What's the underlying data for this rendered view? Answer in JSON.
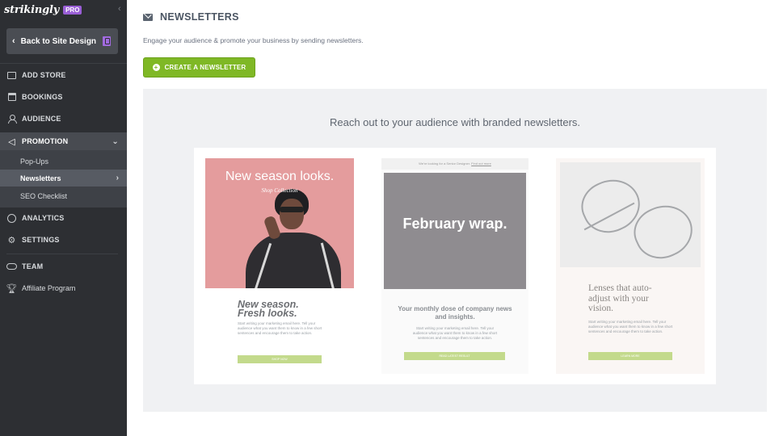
{
  "brand": {
    "logo": "strikingly",
    "badge": "PRO"
  },
  "sidebar": {
    "collapse_glyph": "‹",
    "back_label": "Back to Site Design",
    "items": [
      {
        "label": "ADD STORE",
        "icon": "store-icon"
      },
      {
        "label": "BOOKINGS",
        "icon": "calendar-icon"
      },
      {
        "label": "AUDIENCE",
        "icon": "audience-icon"
      },
      {
        "label": "PROMOTION",
        "icon": "megaphone-icon"
      },
      {
        "label": "ANALYTICS",
        "icon": "analytics-icon"
      },
      {
        "label": "SETTINGS",
        "icon": "gear-icon"
      },
      {
        "label": "TEAM",
        "icon": "team-icon"
      },
      {
        "label": "Affiliate Program",
        "icon": "trophy-icon"
      }
    ],
    "promotion_sub": [
      {
        "label": "Pop-Ups"
      },
      {
        "label": "Newsletters",
        "active": true
      },
      {
        "label": "SEO Checklist"
      }
    ]
  },
  "main": {
    "title": "NEWSLETTERS",
    "subtitle": "Engage your audience & promote your business by sending newsletters.",
    "create_button": "CREATE A NEWSLETTER",
    "panel_title": "Reach out to your audience with branded newsletters."
  },
  "templates": [
    {
      "headline": "New season looks.",
      "tag": "Shop Collection",
      "lead": "New season. Fresh looks.",
      "body": "Start writing your marketing email here. Tell your audience what you want them to know in a few short sentences and encourage them to take action.",
      "button": "SHOP NOW"
    },
    {
      "top_text": "We're looking for a Senior Designer.",
      "top_link": "Find out more",
      "headline": "February wrap.",
      "lead": "Your monthly dose of company news and insights.",
      "body": "Start writing your marketing email here. Tell your audience what you want them to know in a few short sentences and encourage them to take action.",
      "button": "READ LATEST RESULT"
    },
    {
      "lead": "Lenses that auto-adjust with your vision.",
      "body": "Start writing your marketing email here. Tell your audience what you want them to know in a few short sentences and encourage them to take action.",
      "button": "LEARN MORE"
    }
  ],
  "colors": {
    "sidebar_bg": "#2d2f33",
    "accent_green": "#7fb825",
    "pro_purple": "#9a5fd6"
  }
}
